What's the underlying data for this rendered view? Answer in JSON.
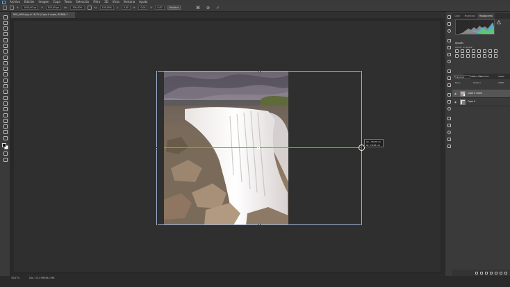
{
  "app": {
    "menu": [
      "Archivo",
      "Edición",
      "Imagen",
      "Capa",
      "Texto",
      "Selección",
      "Filtro",
      "3D",
      "Vista",
      "Ventana",
      "Ayuda"
    ]
  },
  "options_bar": {
    "x_value": "1000,00 px",
    "y_value": "815,00 px",
    "w_value": "100,00%",
    "h_value": "100,00%",
    "angle_value": "0,00",
    "h_skew_value": "0,00",
    "v_skew_value": "0,00",
    "interpolation": "Bicúbica",
    "commit_icons": [
      "cancel-icon",
      "commit-icon"
    ]
  },
  "document": {
    "tab_title": "IMG_0000.jpg al 16,7% (Capa 0 copia, RGB/8) *"
  },
  "canvas": {
    "tooltip_line1": "An.: 78,05 cm",
    "tooltip_line2": "Al.: 78,05 cm"
  },
  "status": {
    "zoom": "16,67%",
    "doc_info": "Doc.: 23,0 MB/46,0 MB"
  },
  "panels": {
    "top_tabs": [
      "Color",
      "Muestras",
      "Histograma"
    ],
    "adjustments_title": "Ajustes",
    "adjustments_subtitle": "Añadir un ajuste",
    "layers_tabs": [
      "Capas",
      "Canales",
      "Trazados"
    ],
    "blend_mode": "Normal",
    "opacity_label": "Opacidad:",
    "opacity_value": "100%",
    "lock_label": "Bloq.:",
    "fill_label": "Relleno:",
    "fill_value": "100%",
    "layers": [
      {
        "name": "Capa 0 copia",
        "selected": true
      },
      {
        "name": "Capa 0",
        "selected": false
      }
    ]
  },
  "colors": {
    "accent": "#4aa3ff",
    "guide": "#e058d8",
    "selected_layer": "#555555"
  }
}
